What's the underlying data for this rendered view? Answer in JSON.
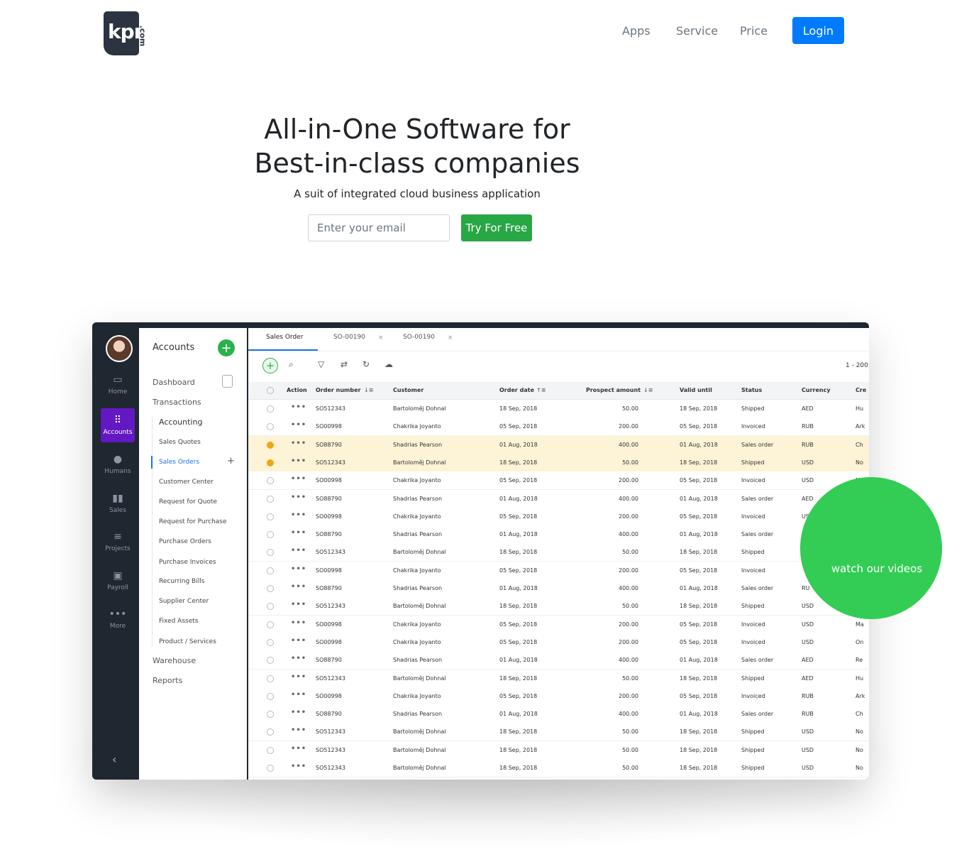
{
  "brand": {
    "logo_text": "kpı",
    "logo_suffix": ".com"
  },
  "nav": {
    "items": [
      "Apps",
      "Service",
      "Price"
    ],
    "login_label": "Login"
  },
  "hero": {
    "title_line1": "All-in-One Software for",
    "title_line2": "Best-in-class companies",
    "subtitle": "A suit of integrated cloud business application",
    "email_placeholder": "Enter your email",
    "cta_label": "Try For Free"
  },
  "video": {
    "label": "watch our videos"
  },
  "app": {
    "rail": [
      "Home",
      "Accounts",
      "Humans",
      "Sales",
      "Projects",
      "Payroll",
      "More"
    ],
    "rail_icons": [
      "home-icon",
      "grid-icon",
      "person-icon",
      "bar-chart-icon",
      "list-icon",
      "wallet-icon",
      "more-icon"
    ],
    "sidebar": {
      "title": "Accounts",
      "dashboard": "Dashboard",
      "transactions": "Transactions",
      "accounting": "Accounting",
      "sub_items": [
        "Sales Quotes",
        "Sales Orders",
        "Customer Center",
        "Request for Quote",
        "Request for Purchase",
        "Purchase Orders",
        "Purchase Invoices",
        "Recurring Bills",
        "Supplier Center",
        "Fixed Assets",
        "Product / Services"
      ],
      "warehouse": "Warehouse",
      "reports": "Reports"
    },
    "tabs": [
      "Sales Order",
      "SO-00190",
      "SO-00190"
    ],
    "count_label": "1 - 200",
    "columns": [
      "Action",
      "Order number",
      "Customer",
      "Order date",
      "Prospect amount",
      "Valid until",
      "Status",
      "Currency",
      "Cre"
    ],
    "rows": [
      {
        "order": "SO512343",
        "customer": "Bartoloměj Dohnal",
        "date": "18 Sep, 2018",
        "amount": "50.00",
        "valid": "18 Sep, 2018",
        "status": "Shipped",
        "currency": "AED",
        "cre": "Hu",
        "selected": false
      },
      {
        "order": "SO00998",
        "customer": "Chakrika Joyanto",
        "date": "05 Sep, 2018",
        "amount": "200.00",
        "valid": "05 Sep, 2018",
        "status": "Invoiced",
        "currency": "RUB",
        "cre": "Ark",
        "selected": false
      },
      {
        "order": "SO88790",
        "customer": "Shadrias Pearson",
        "date": "01 Aug, 2018",
        "amount": "400.00",
        "valid": "01 Aug, 2018",
        "status": "Sales order",
        "currency": "RUB",
        "cre": "Ch",
        "selected": true
      },
      {
        "order": "SO512343",
        "customer": "Bartoloměj Dohnal",
        "date": "18 Sep, 2018",
        "amount": "50.00",
        "valid": "18 Sep, 2018",
        "status": "Shipped",
        "currency": "USD",
        "cre": "No",
        "selected": true
      },
      {
        "order": "SO00998",
        "customer": "Chakrika Joyanto",
        "date": "05 Sep, 2018",
        "amount": "200.00",
        "valid": "05 Sep, 2018",
        "status": "Invoiced",
        "currency": "USD",
        "cre": "M",
        "selected": false
      },
      {
        "order": "SO88790",
        "customer": "Shadrias Pearson",
        "date": "01 Aug, 2018",
        "amount": "400.00",
        "valid": "01 Aug, 2018",
        "status": "Sales order",
        "currency": "AED",
        "cre": "",
        "selected": false
      },
      {
        "order": "SO00998",
        "customer": "Chakrika Joyanto",
        "date": "05 Sep, 2018",
        "amount": "200.00",
        "valid": "05 Sep, 2018",
        "status": "Invoiced",
        "currency": "US",
        "cre": "",
        "selected": false
      },
      {
        "order": "SO88790",
        "customer": "Shadrias Pearson",
        "date": "01 Aug, 2018",
        "amount": "400.00",
        "valid": "01 Aug, 2018",
        "status": "Sales order",
        "currency": "",
        "cre": "",
        "selected": false
      },
      {
        "order": "SO512343",
        "customer": "Bartoloměj Dohnal",
        "date": "18 Sep, 2018",
        "amount": "50.00",
        "valid": "18 Sep, 2018",
        "status": "Shipped",
        "currency": "",
        "cre": "",
        "selected": false
      },
      {
        "order": "SO00998",
        "customer": "Chakrika Joyanto",
        "date": "05 Sep, 2018",
        "amount": "200.00",
        "valid": "05 Sep, 2018",
        "status": "Invoiced",
        "currency": "",
        "cre": "",
        "selected": false
      },
      {
        "order": "SO88790",
        "customer": "Shadrias Pearson",
        "date": "01 Aug, 2018",
        "amount": "400.00",
        "valid": "01 Aug, 2018",
        "status": "Sales order",
        "currency": "RU",
        "cre": "",
        "selected": false
      },
      {
        "order": "SO512343",
        "customer": "Bartoloměj Dohnal",
        "date": "18 Sep, 2018",
        "amount": "50.00",
        "valid": "18 Sep, 2018",
        "status": "Shipped",
        "currency": "USD",
        "cre": "",
        "selected": false
      },
      {
        "order": "SO00998",
        "customer": "Chakrika Joyanto",
        "date": "05 Sep, 2018",
        "amount": "200.00",
        "valid": "05 Sep, 2018",
        "status": "Invoiced",
        "currency": "USD",
        "cre": "Ma",
        "selected": false
      },
      {
        "order": "SO00998",
        "customer": "Chakrika Joyanto",
        "date": "05 Sep, 2018",
        "amount": "200.00",
        "valid": "05 Sep, 2018",
        "status": "Invoiced",
        "currency": "USD",
        "cre": "On",
        "selected": false
      },
      {
        "order": "SO88790",
        "customer": "Shadrias Pearson",
        "date": "01 Aug, 2018",
        "amount": "400.00",
        "valid": "01 Aug, 2018",
        "status": "Sales order",
        "currency": "AED",
        "cre": "Re",
        "selected": false
      },
      {
        "order": "SO512343",
        "customer": "Bartoloměj Dohnal",
        "date": "18 Sep, 2018",
        "amount": "50.00",
        "valid": "18 Sep, 2018",
        "status": "Shipped",
        "currency": "AED",
        "cre": "Hu",
        "selected": false
      },
      {
        "order": "SO00998",
        "customer": "Chakrika Joyanto",
        "date": "05 Sep, 2018",
        "amount": "200.00",
        "valid": "05 Sep, 2018",
        "status": "Invoiced",
        "currency": "RUB",
        "cre": "Ark",
        "selected": false
      },
      {
        "order": "SO88790",
        "customer": "Shadrias Pearson",
        "date": "01 Aug, 2018",
        "amount": "400.00",
        "valid": "01 Aug, 2018",
        "status": "Sales order",
        "currency": "RUB",
        "cre": "Ch",
        "selected": false
      },
      {
        "order": "SO512343",
        "customer": "Bartoloměj Dohnal",
        "date": "18 Sep, 2018",
        "amount": "50.00",
        "valid": "18 Sep, 2018",
        "status": "Shipped",
        "currency": "USD",
        "cre": "No",
        "selected": false
      },
      {
        "order": "SO512343",
        "customer": "Bartoloměj Dohnal",
        "date": "18 Sep, 2018",
        "amount": "50.00",
        "valid": "18 Sep, 2018",
        "status": "Shipped",
        "currency": "USD",
        "cre": "No",
        "selected": false
      },
      {
        "order": "SO512343",
        "customer": "Bartoloměj Dohnal",
        "date": "18 Sep, 2018",
        "amount": "50.00",
        "valid": "18 Sep, 2018",
        "status": "Shipped",
        "currency": "USD",
        "cre": "No",
        "selected": false
      }
    ]
  },
  "colors": {
    "primary": "#007bff",
    "success": "#28a745",
    "video": "#33cc55",
    "rail": "#1f2730",
    "rail_active": "#6418c3",
    "row_selected": "#fdf3d6"
  }
}
